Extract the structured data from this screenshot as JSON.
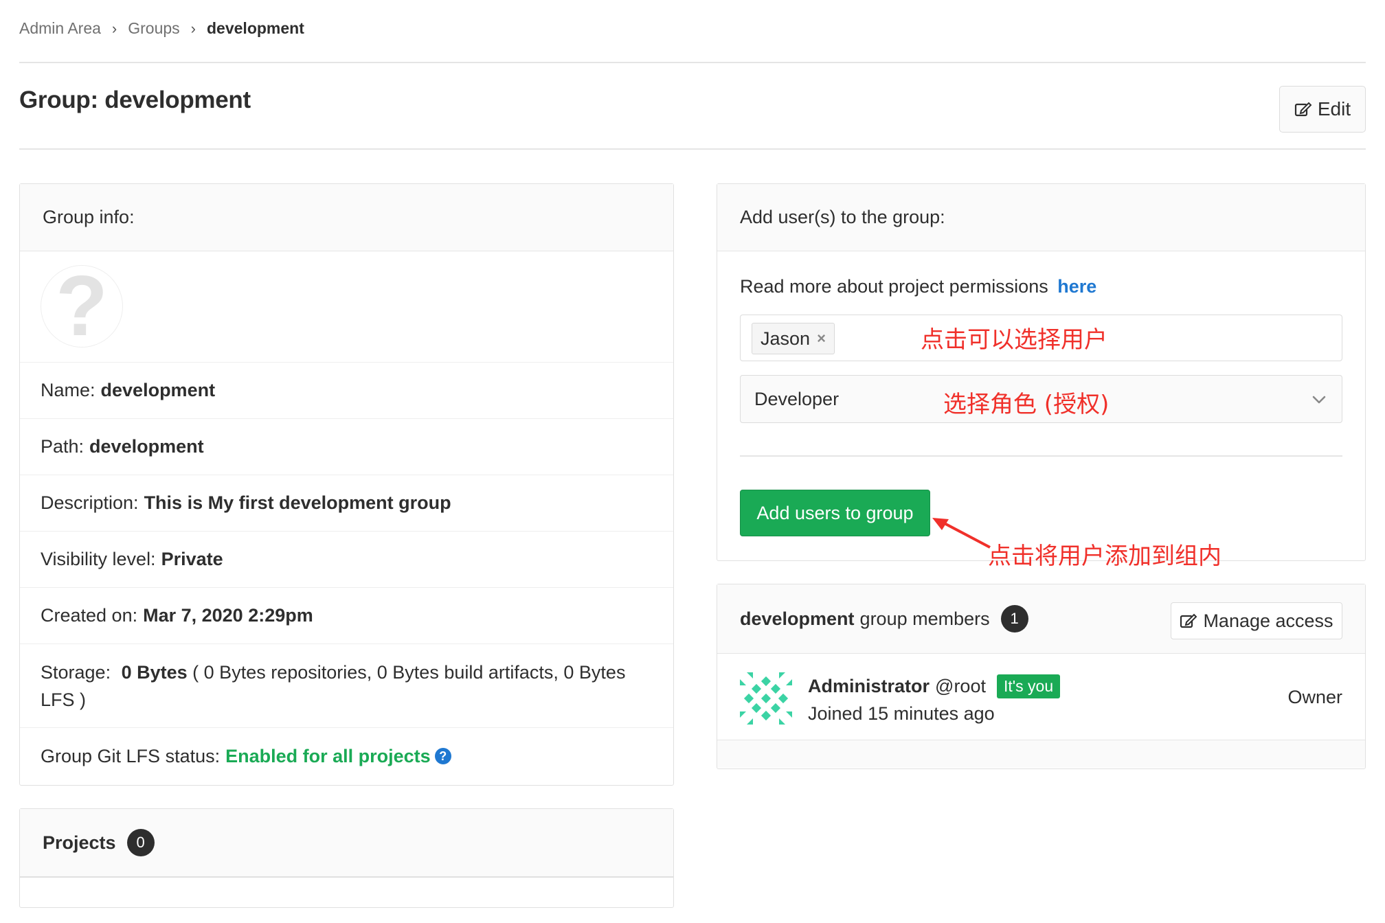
{
  "breadcrumb": {
    "items": [
      "Admin Area",
      "Groups",
      "development"
    ],
    "separator": ">"
  },
  "header": {
    "title": "Group: development",
    "edit_label": "Edit"
  },
  "group_info": {
    "heading": "Group info:",
    "avatar_glyph": "?",
    "name_label": "Name:",
    "name_value": "development",
    "path_label": "Path:",
    "path_value": "development",
    "description_label": "Description:",
    "description_value": "This is My first development group",
    "visibility_label": "Visibility level:",
    "visibility_value": "Private",
    "created_label": "Created on:",
    "created_value": "Mar 7, 2020 2:29pm",
    "storage_label": "Storage:",
    "storage_value": "0 Bytes",
    "storage_detail": "( 0 Bytes repositories, 0 Bytes build artifacts, 0 Bytes LFS )",
    "lfs_label": "Group Git LFS status:",
    "lfs_value": "Enabled for all projects",
    "lfs_help_glyph": "?"
  },
  "projects": {
    "heading": "Projects",
    "count": "0"
  },
  "add_users": {
    "heading": "Add user(s) to the group:",
    "permissions_text": "Read more about project permissions",
    "permissions_link": "here",
    "selected_user": "Jason",
    "remove_glyph": "×",
    "role_value": "Developer",
    "submit_label": "Add users to group"
  },
  "annotations": {
    "select_user": "点击可以选择用户",
    "select_role": "选择角色 (授权)",
    "add_to_group": "点击将用户添加到组内"
  },
  "members": {
    "group_name": "development",
    "heading_suffix": "group members",
    "count": "1",
    "manage_label": "Manage access",
    "list": [
      {
        "name": "Administrator",
        "username": "@root",
        "badge": "It's you",
        "joined": "Joined 15 minutes ago",
        "role": "Owner"
      }
    ]
  },
  "colors": {
    "green": "#1aaa55",
    "link_blue": "#1f78d1",
    "annotation_red": "#f0302a",
    "identicon": "#3bd3a4"
  },
  "icons": [
    "chevron-right-icon",
    "edit-icon",
    "help-icon",
    "close-icon",
    "chevron-down-icon",
    "identicon-avatar"
  ]
}
